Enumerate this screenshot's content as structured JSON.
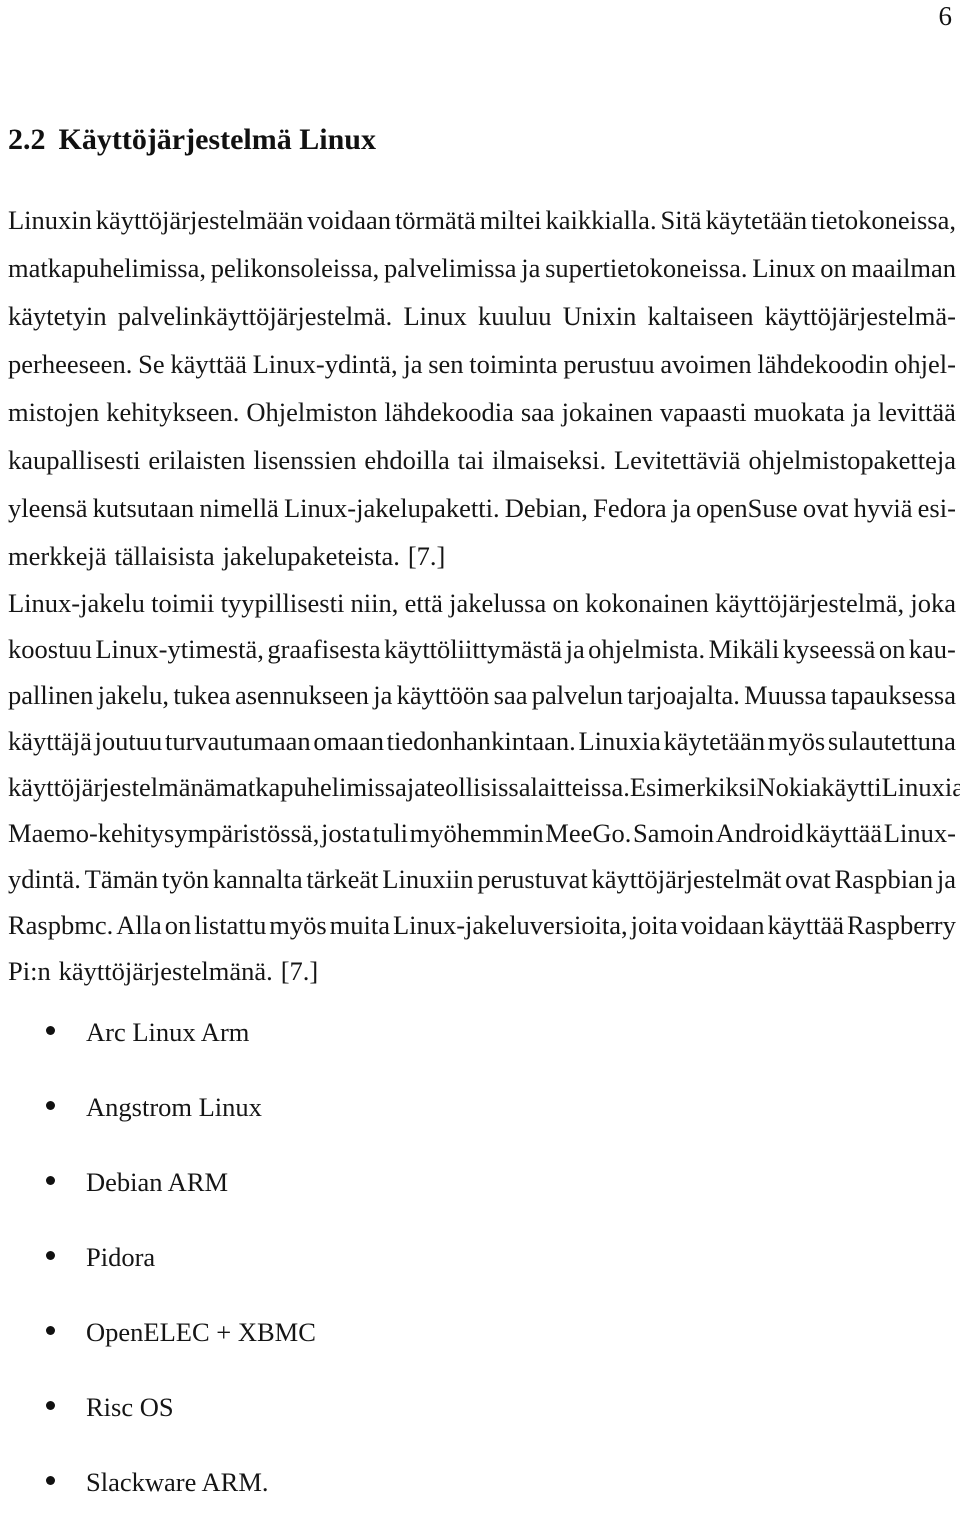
{
  "document": {
    "page_number": "6",
    "heading": {
      "number": "2.2",
      "title": "Käyttöjärjestelmä Linux"
    },
    "paragraphs": [
      {
        "id": "paragraph-1",
        "text": "Linuxin käyttöjärjestelmään voidaan törmätä miltei kaikkialla. Sitä käytetään tietokoneissa, matkapuhelimissa, pelikonsoleissa, palvelimissa ja supertietokoneissa. Linux on maailman käytetyin palvelinkäyttöjärjestelmä. Linux kuuluu Unixin kaltaiseen käyttöjärjestelmäperheeseen. Se käyttää Linux-ydintä, ja sen toiminta perustuu avoimen lähdekoodin ohjelmistojen kehitykseen. Ohjelmiston lähdekoodia saa jokainen vapaasti muokata ja levittää kaupallisesti erilaisten lisenssien ehdoilla tai ilmaiseksi. Levitettäviä ohjelmistopaketteja yleensä kutsutaan nimellä Linux-jakelupaketti. Debian, Fedora ja openSuse ovat hyviä esimerkkejä tällaisista jakelupaketeista. [7.]",
        "lines": [
          "Linuxin käyttöjärjestelmään voidaan törmätä miltei kaikkialla. Sitä käytetään tietokoneissa,",
          "matkapuhelimissa, pelikonsoleissa, palvelimissa ja supertietokoneissa. Linux on maailman",
          "käytetyin palvelinkäyttöjärjestelmä. Linux kuuluu Unixin kaltaiseen käyttöjärjestelmä-",
          "perheeseen. Se käyttää Linux-ydintä, ja sen toiminta perustuu avoimen lähdekoodin ohjel-",
          "mistojen kehitykseen. Ohjelmiston lähdekoodia saa jokainen vapaasti muokata ja levittää",
          "kaupallisesti erilaisten lisenssien ehdoilla tai ilmaiseksi. Levitettäviä ohjelmistopaketteja",
          "yleensä kutsutaan nimellä Linux-jakelupaketti. Debian, Fedora ja openSuse ovat hyviä esi-",
          "merkkejä tällaisista jakelupaketeista. [7.]"
        ]
      },
      {
        "id": "paragraph-2",
        "text": "Linux-jakelu toimii tyypillisesti niin, että jakelussa on kokonainen käyttöjärjestelmä, joka koostuu Linux-ytimestä, graafisesta käyttöliittymästä ja ohjelmista. Mikäli kyseessä on kaupallinen jakelu, tukea asennukseen ja käyttöön saa palvelun tarjoajalta. Muussa tapauksessa käyttäjä joutuu turvautumaan omaan tiedonhankintaan. Linuxia käytetään myös sulautettuna käyttöjärjestelmänä matkapuhelimissa ja teollisissa laitteissa. Esimerkiksi Nokia käytti Linuxia Maemo-kehitysympäristössä, josta tuli myöhemmin MeeGo. Samoin Android käyttää Linux-ydintä. Tämän työn kannalta tärkeät Linuxiin perustuvat käyttöjärjestelmät ovat Raspbian ja Raspbmc. Alla on listattu myös muita Linux-jakeluversioita, joita voidaan käyttää Raspberry Pi:n käyttöjärjestelmänä. [7.]",
        "lines": [
          "Linux-jakelu toimii tyypillisesti niin, että jakelussa on kokonainen käyttöjärjestelmä, joka",
          "koostuu Linux-ytimestä, graafisesta käyttöliittymästä ja ohjelmista. Mikäli kyseessä on kau-",
          "pallinen jakelu, tukea asennukseen ja käyttöön saa palvelun tarjoajalta. Muussa tapauksessa",
          "käyttäjä joutuu turvautumaan omaan tiedonhankintaan. Linuxia käytetään myös sulautettuna",
          "käyttöjärjestelmänä matkapuhelimissa ja teollisissa laitteissa. Esimerkiksi Nokia käytti Linuxia",
          "Maemo-kehitysympäristössä, josta tuli myöhemmin MeeGo. Samoin Android käyttää Linux-",
          "ydintä. Tämän työn kannalta tärkeät Linuxiin perustuvat käyttöjärjestelmät ovat Raspbian ja",
          "Raspbmc. Alla on listattu myös muita Linux-jakeluversioita, joita voidaan käyttää Raspberry",
          "Pi:n käyttöjärjestelmänä. [7.]"
        ]
      }
    ],
    "bullet_list": [
      "Arc Linux Arm",
      "Angstrom Linux",
      "Debian ARM",
      "Pidora",
      "OpenELEC + XBMC",
      "Risc OS",
      "Slackware ARM."
    ]
  }
}
